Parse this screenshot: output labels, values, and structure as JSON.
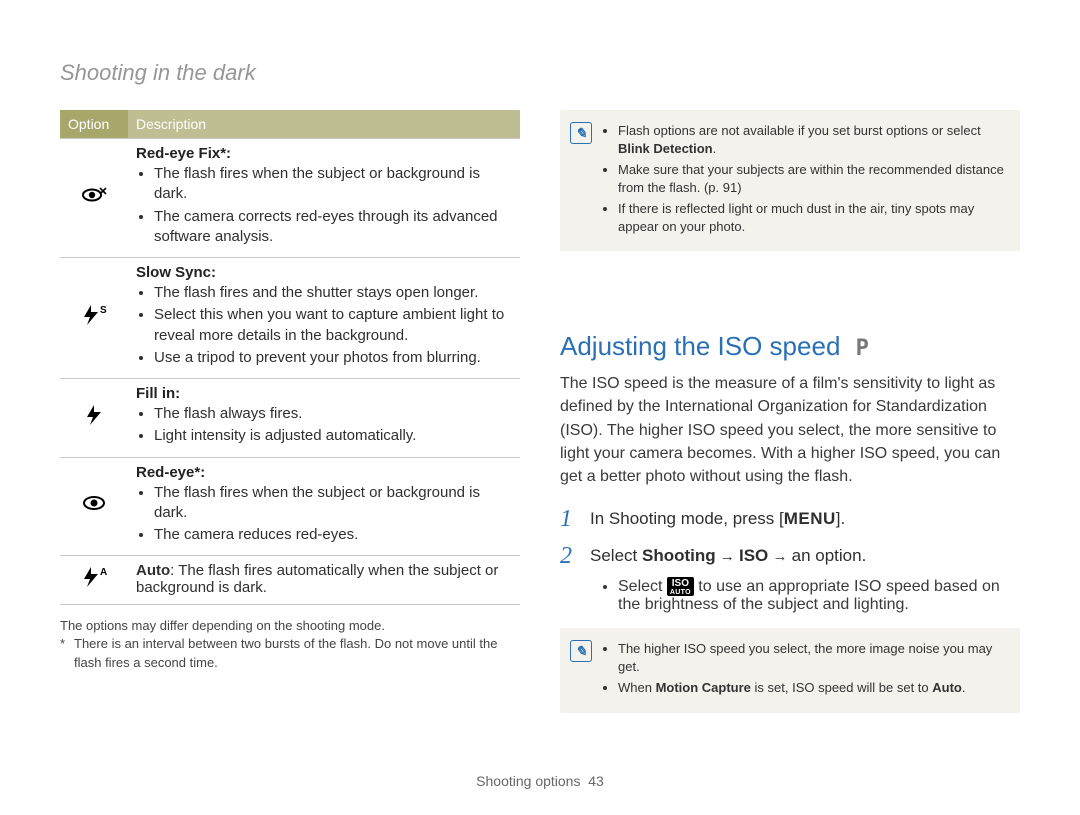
{
  "header": "Shooting in the dark",
  "table": {
    "col1": "Option",
    "col2": "Description",
    "rows": [
      {
        "icon": "red-eye-fix",
        "title": "Red-eye Fix",
        "title_suffix": "*:",
        "items": [
          "The flash fires when the subject or background is dark.",
          "The camera corrects red-eyes through its advanced software analysis."
        ]
      },
      {
        "icon": "slow-sync",
        "title": "Slow Sync",
        "title_suffix": ":",
        "items": [
          "The flash fires and the shutter stays open longer.",
          "Select this when you want to capture ambient light to reveal more details in the background.",
          "Use a tripod to prevent your photos from blurring."
        ]
      },
      {
        "icon": "fill-in",
        "title": "Fill in",
        "title_suffix": ":",
        "items": [
          "The flash always fires.",
          "Light intensity is adjusted automatically."
        ]
      },
      {
        "icon": "red-eye",
        "title": "Red-eye",
        "title_suffix": "*:",
        "items": [
          "The flash fires when the subject or background is dark.",
          "The camera reduces red-eyes."
        ]
      },
      {
        "icon": "auto",
        "auto_label": "Auto",
        "auto_text": ": The flash fires automatically when the subject or background is dark."
      }
    ]
  },
  "footnotes": {
    "line1": "The options may differ depending on the shooting mode.",
    "line2": "There is an interval between two bursts of the flash. Do not move until the flash fires a second time."
  },
  "notes_top": {
    "items": [
      {
        "pre": "Flash options are not available if you set burst options or select ",
        "bold": "Blink Detection",
        "post": "."
      },
      {
        "pre": "Make sure that your subjects are within the recommended distance from the flash. (p. 91)",
        "bold": "",
        "post": ""
      },
      {
        "pre": "If there is reflected light or much dust in the air, tiny spots may appear on your photo.",
        "bold": "",
        "post": ""
      }
    ]
  },
  "section": {
    "heading": "Adjusting the ISO speed",
    "mode_badge": "P",
    "body": "The ISO speed is the measure of a film's sensitivity to light as defined by the International Organization for Standardization (ISO). The higher ISO speed you select, the more sensitive to light your camera becomes. With a higher ISO speed, you can get a better photo without using the flash.",
    "steps": {
      "s1_pre": "In Shooting mode, press [",
      "s1_menu": "MENU",
      "s1_post": "].",
      "s2_pre": "Select ",
      "s2_b1": "Shooting",
      "s2_arrow": " → ",
      "s2_b2": "ISO",
      "s2_post": " an option."
    },
    "sub": {
      "pre": "Select ",
      "iso_label": "ISO",
      "auto_label": "AUTO",
      "post": " to use an appropriate ISO speed based on the brightness of the subject and lighting."
    }
  },
  "notes_bottom": {
    "items": [
      {
        "pre": "The higher ISO speed you select, the more image noise you may get.",
        "bold": "",
        "post": ""
      },
      {
        "pre": "When ",
        "bold": "Motion Capture",
        "post": " is set, ISO speed will be set to ",
        "bold2": "Auto",
        "post2": "."
      }
    ]
  },
  "footer": {
    "label": "Shooting options",
    "page": "43"
  }
}
